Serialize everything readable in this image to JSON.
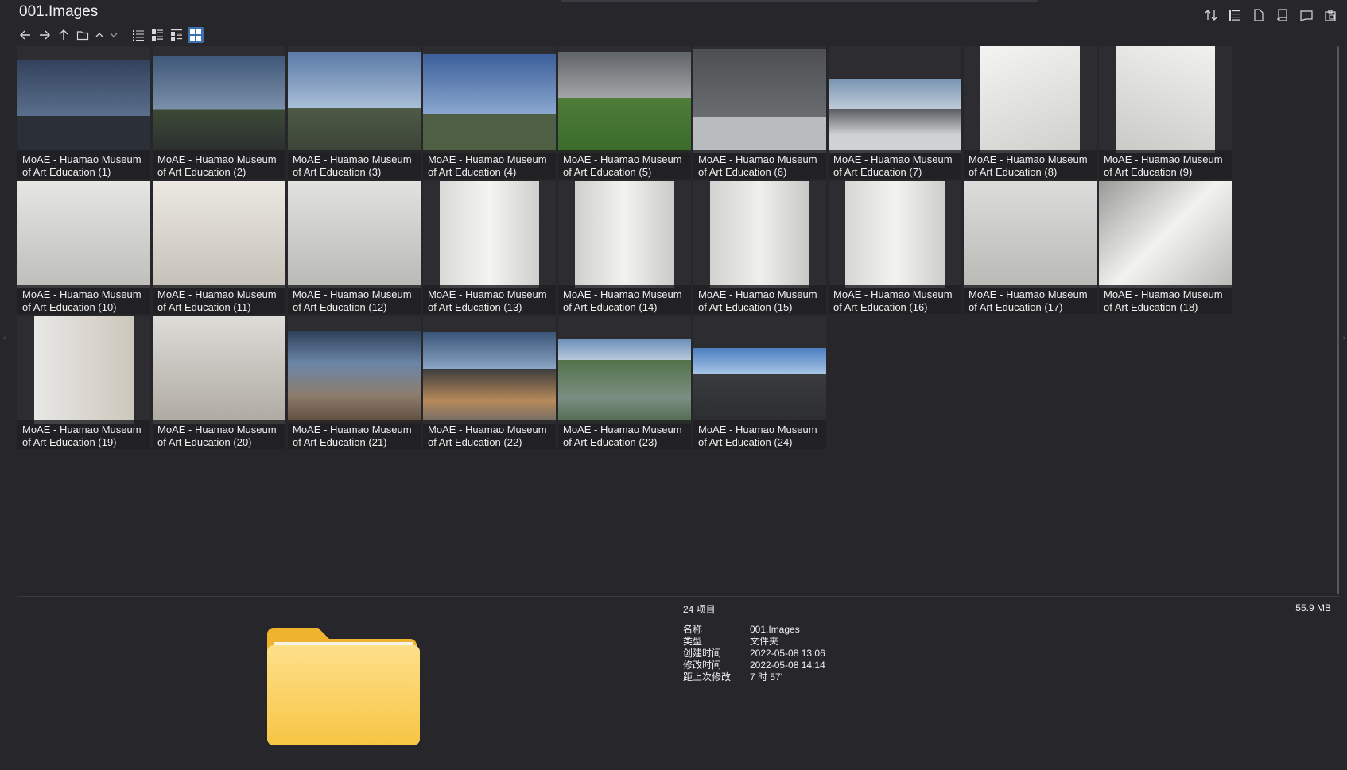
{
  "window": {
    "title": "001.Images"
  },
  "toolbar": {
    "nav": [
      {
        "name": "back-icon",
        "glyph": "←"
      },
      {
        "name": "forward-icon",
        "glyph": "→"
      },
      {
        "name": "up-icon",
        "glyph": "↑"
      },
      {
        "name": "folder-icon",
        "glyph": "folder"
      },
      {
        "name": "chevron-up-icon",
        "glyph": "^"
      },
      {
        "name": "chevron-down-icon",
        "glyph": "v"
      }
    ],
    "views": [
      {
        "name": "list-view-icon"
      },
      {
        "name": "details-view-icon"
      },
      {
        "name": "tiles-view-icon"
      },
      {
        "name": "thumbnail-view-icon",
        "active": true
      }
    ],
    "right": [
      {
        "name": "sort-icon"
      },
      {
        "name": "group-icon"
      },
      {
        "name": "new-file-icon"
      },
      {
        "name": "layout-icon"
      },
      {
        "name": "preview-pane-icon"
      },
      {
        "name": "clipboard-icon"
      }
    ]
  },
  "files": [
    {
      "label": "MoAE - Huamao Museum of Art Education (1)",
      "scene": "dusk-curve"
    },
    {
      "label": "MoAE - Huamao Museum of Art Education (2)",
      "scene": "dusk-road"
    },
    {
      "label": "MoAE - Huamao Museum of Art Education (3)",
      "scene": "sky-wall"
    },
    {
      "label": "MoAE - Huamao Museum of Art Education (4)",
      "scene": "sky-wall2"
    },
    {
      "label": "MoAE - Huamao Museum of Art Education (5)",
      "scene": "green-curve"
    },
    {
      "label": "MoAE - Huamao Museum of Art Education (6)",
      "scene": "dark-facade"
    },
    {
      "label": "MoAE - Huamao Museum of Art Education (7)",
      "scene": "low-facade"
    },
    {
      "label": "MoAE - Huamao Museum of Art Education (8)",
      "scene": "white-room"
    },
    {
      "label": "MoAE - Huamao Museum of Art Education (9)",
      "scene": "white-room2"
    },
    {
      "label": "MoAE - Huamao Museum of Art Education (10)",
      "scene": "white-hall"
    },
    {
      "label": "MoAE - Huamao Museum of Art Education (11)",
      "scene": "white-hall2"
    },
    {
      "label": "MoAE - Huamao Museum of Art Education (12)",
      "scene": "white-hall3"
    },
    {
      "label": "MoAE - Huamao Museum of Art Education (13)",
      "scene": "white-vertical"
    },
    {
      "label": "MoAE - Huamao Museum of Art Education (14)",
      "scene": "white-vertical2"
    },
    {
      "label": "MoAE - Huamao Museum of Art Education (15)",
      "scene": "white-vertical3"
    },
    {
      "label": "MoAE - Huamao Museum of Art Education (16)",
      "scene": "white-vertical4"
    },
    {
      "label": "MoAE - Huamao Museum of Art Education (17)",
      "scene": "white-atrium"
    },
    {
      "label": "MoAE - Huamao Museum of Art Education (18)",
      "scene": "white-angle"
    },
    {
      "label": "MoAE - Huamao Museum of Art Education (19)",
      "scene": "white-shelf"
    },
    {
      "label": "MoAE - Huamao Museum of Art Education (20)",
      "scene": "white-corridor"
    },
    {
      "label": "MoAE - Huamao Museum of Art Education (21)",
      "scene": "terrace"
    },
    {
      "label": "MoAE - Huamao Museum of Art Education (22)",
      "scene": "terrace-dusk"
    },
    {
      "label": "MoAE - Huamao Museum of Art Education (23)",
      "scene": "aerial"
    },
    {
      "label": "MoAE - Huamao Museum of Art Education (24)",
      "scene": "sky-curve"
    }
  ],
  "details": {
    "count": "24 项目",
    "size": "55.9 MB",
    "rows": [
      {
        "key": "名称",
        "value": "001.Images"
      },
      {
        "key": "类型",
        "value": "文件夹"
      },
      {
        "key": "创建时间",
        "value": "2022-05-08  13:06"
      },
      {
        "key": "修改时间",
        "value": "2022-05-08  14:14"
      },
      {
        "key": "距上次修改",
        "value": "7 时 57'"
      }
    ]
  },
  "colors": {
    "background": "#26262b",
    "accent": "#3c6fb0",
    "folder_front": "#fcd25c",
    "folder_back": "#f2b53a"
  }
}
